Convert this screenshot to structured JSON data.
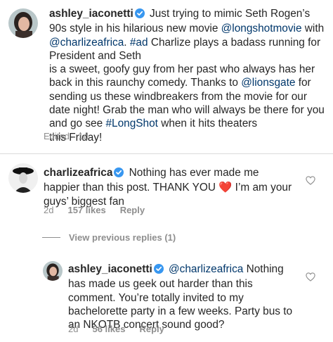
{
  "post_caption": {
    "username": "ashley_iaconetti",
    "segments": {
      "s1": "Just trying to mimic Seth Rogen’s 90s style in his hilarious new movie ",
      "s2": "@longshotmovie",
      "s3": " with ",
      "s4": "@charlizeafrica",
      "s5": ". ",
      "s6": "#ad",
      "s7": " Charlize plays a badass running for President and Seth",
      "s8": "is a sweet, goofy guy from her past who always has her back in this raunchy comedy. Thanks to ",
      "s9": "@lionsgate",
      "s10": " for sending us these windbreakers from the movie for our date night! Grab the man who will always be there for you and go see ",
      "s11": "#LongShot",
      "s12": " when it hits theaters",
      "s13": "this Friday!"
    },
    "meta": {
      "edited": "Edited",
      "dot": "·",
      "time": "1d"
    }
  },
  "comment": {
    "username": "charlizeafrica",
    "text": "Nothing has ever made me happier than this post. THANK YOU",
    "emoji": "❤️",
    "text2": " I’m am your guys’ biggest fan",
    "time": "2d",
    "likes": "157 likes",
    "reply": "Reply"
  },
  "view_replies": "View previous replies (1)",
  "reply": {
    "username": "ashley_iaconetti",
    "mention": "@charlizeafrica",
    "text": " Nothing has made us geek out harder than this comment. You’re totally invited to my bachelorette party in a few weeks. Party bus to an NKOTB concert sound good?",
    "time": "2d",
    "likes": "56 likes",
    "reply": "Reply"
  },
  "colors": {
    "link": "#00376b",
    "meta": "#8e8e8e",
    "verified": "#3897f0",
    "heart_outline": "#8e8e8e"
  },
  "icons": [
    "verified-badge-icon",
    "heart-icon"
  ]
}
